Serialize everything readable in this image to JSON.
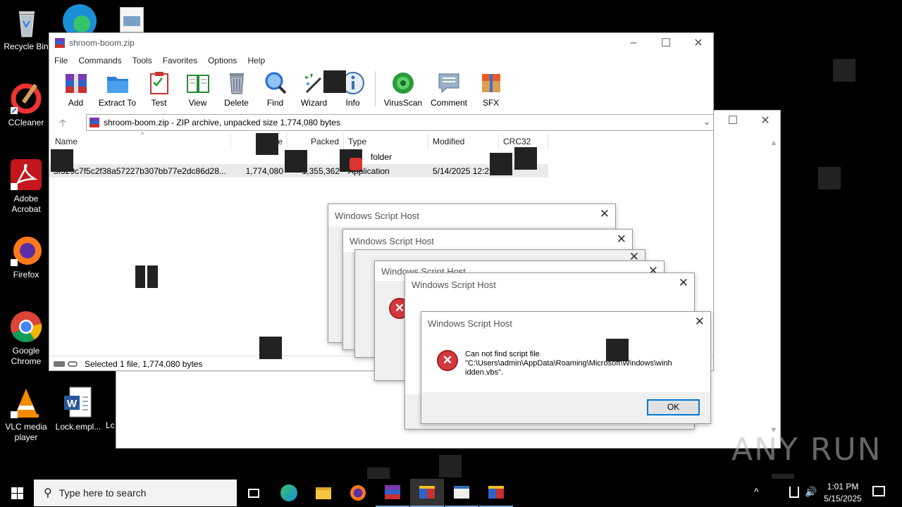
{
  "desktop": {
    "icons": [
      {
        "label": "Recycle Bin"
      },
      {
        "label": "CCleaner"
      },
      {
        "label": "Adobe Acrobat"
      },
      {
        "label": "Firefox"
      },
      {
        "label": "Google Chrome"
      },
      {
        "label": "VLC media player"
      },
      {
        "label": "Lock.empl..."
      },
      {
        "label": "Lc"
      }
    ]
  },
  "winrar": {
    "title": "shroom-boom.zip",
    "menu": [
      "File",
      "Commands",
      "Tools",
      "Favorites",
      "Options",
      "Help"
    ],
    "toolbar": [
      "Add",
      "Extract To",
      "Test",
      "View",
      "Delete",
      "Find",
      "Wizard",
      "Info",
      "VirusScan",
      "Comment",
      "SFX"
    ],
    "address": "shroom-boom.zip - ZIP archive, unpacked size 1,774,080 bytes",
    "columns": [
      "Name",
      "e",
      "Packed",
      "Type",
      "Modified",
      "CRC32"
    ],
    "rows": [
      {
        "name": "",
        "size": "",
        "packed": "",
        "type": "folder",
        "modified": ""
      },
      {
        "name": "5f529c7f5c2f38a57227b307bb77e2dc86d28...",
        "size": "1,774,080",
        "packed": "1,355,362",
        "type": "Application",
        "modified": "5/14/2025 12:2..."
      }
    ],
    "status": "Selected 1 file, 1,774,080 bytes"
  },
  "dialogs": {
    "title": "Windows Script Host",
    "message_line1": "Can not find script file",
    "message_line2": "\"C:\\Users\\admin\\AppData\\Roaming\\Microsoft\\Windows\\winh",
    "message_line3": "idden.vbs\".",
    "ok": "OK"
  },
  "taskbar": {
    "search_placeholder": "Type here to search",
    "time": "1:01 PM",
    "date": "5/15/2025"
  },
  "watermark": "ANY RUN",
  "colors": {
    "accent": "#0078d7",
    "error": "#d3383d"
  }
}
